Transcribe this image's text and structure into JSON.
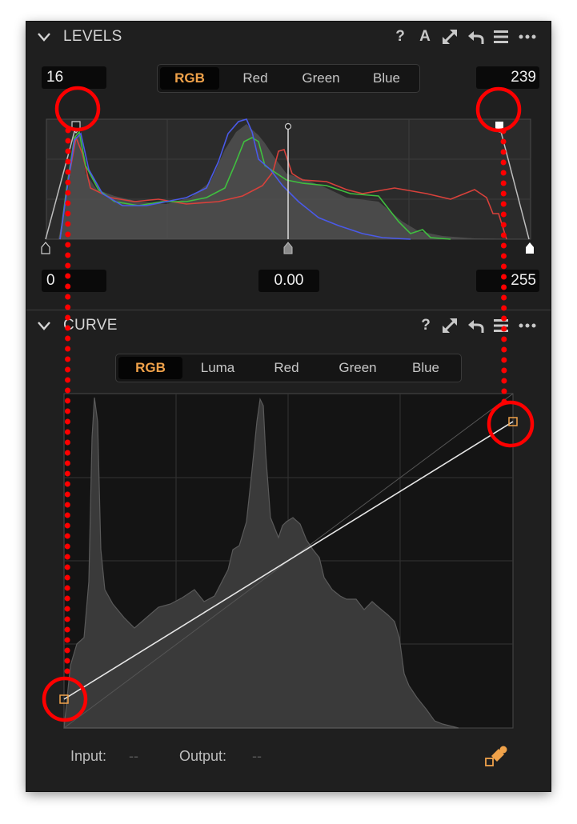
{
  "levels": {
    "title": "LEVELS",
    "tools": {
      "help": "?",
      "auto": "A"
    },
    "input_black": "16",
    "input_white": "239",
    "output_black": "0",
    "midtone": "0.00",
    "output_white": "255",
    "channels": [
      {
        "label": "RGB",
        "active": true
      },
      {
        "label": "Red",
        "active": false
      },
      {
        "label": "Green",
        "active": false
      },
      {
        "label": "Blue",
        "active": false
      }
    ]
  },
  "curve": {
    "title": "CURVE",
    "tools": {
      "help": "?"
    },
    "channels": [
      {
        "label": "RGB",
        "active": true
      },
      {
        "label": "Luma",
        "active": false
      },
      {
        "label": "Red",
        "active": false
      },
      {
        "label": "Green",
        "active": false
      },
      {
        "label": "Blue",
        "active": false
      }
    ],
    "points": [
      {
        "input": 0,
        "output": 16
      },
      {
        "input": 255,
        "output": 239
      }
    ],
    "input_label": "Input:",
    "input_value": "--",
    "output_label": "Output:",
    "output_value": "--"
  },
  "colors": {
    "accent": "#f0a24a",
    "panel": "#1f1f1f",
    "annotation": "#ff0000",
    "hist_red": "#d8413b",
    "hist_green": "#3fbf3f",
    "hist_blue": "#4a5ae8"
  },
  "icons": [
    "chevron-down-icon",
    "help-icon",
    "auto-icon",
    "expand-icon",
    "reset-icon",
    "menu-icon",
    "more-icon",
    "picker-icon"
  ]
}
